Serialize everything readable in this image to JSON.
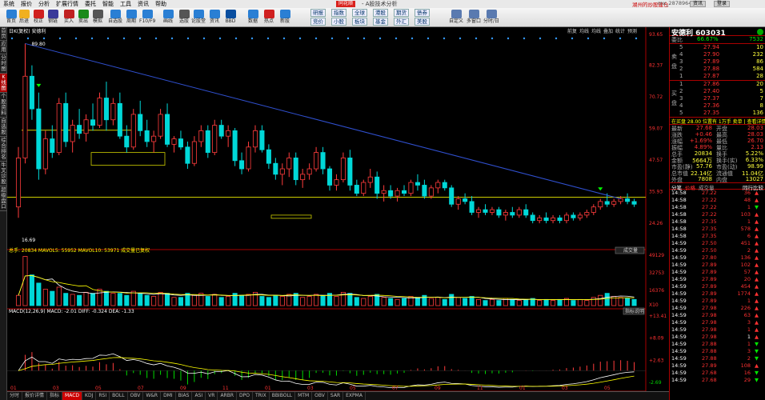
{
  "menu": [
    "系统",
    "报价",
    "分析",
    "扩展行情",
    "委托",
    "智能",
    "工具",
    "资讯",
    "帮助"
  ],
  "app_logo": "同花顺",
  "window_title": "- A股技术分析",
  "user_label": "湖州的炒股建仓",
  "account": "mx_287896434",
  "top_buttons": [
    "资讯",
    "登录"
  ],
  "toolbar": [
    "首页",
    "后退",
    "校正",
    "钢链",
    "买入",
    "卖出",
    "模拟",
    "自选股",
    "周期",
    "F10/F9",
    "画线",
    "选股",
    "论股堂",
    "资讯",
    "BBD",
    "数据",
    "热点",
    "新股"
  ],
  "toolbar_grid": [
    [
      "研报",
      "竞价"
    ],
    [
      "指数",
      "小股"
    ],
    [
      "全球",
      "板块"
    ],
    [
      "港股",
      "基金"
    ],
    [
      "期货",
      "外汇"
    ],
    [
      "债券",
      "美股"
    ]
  ],
  "toolbar_right": [
    "自定义",
    "多窗口",
    "分时/日"
  ],
  "left_nav": [
    "首页",
    "应用",
    "分时图",
    "K线图",
    "个股资料",
    "自选股",
    "综合排名",
    "牛叉诊股",
    "超级盘口"
  ],
  "kline": {
    "header": "日K(复权)   安德利",
    "right_tags": [
      "前复",
      "均线",
      "均线",
      "叠加",
      "统计",
      "预测"
    ],
    "max_label": "89.80",
    "min_label": "16.69",
    "y_ticks": [
      "93.65",
      "82.37",
      "70.72",
      "59.07",
      "47.57",
      "35.93",
      "24.26"
    ],
    "volume_header": "总手: 20834  MAVOL5: 55952  MAVOL10: 53971  成交量已复权",
    "vol_sel": "成交量",
    "vol_ticks": [
      "49129",
      "32753",
      "16376",
      "X10"
    ],
    "macd_header": "MACD(12,26,9)  MACD: -2.01  DIFF: -0.324  DEA: -1.33",
    "macd_btn": "指标说明",
    "macd_ticks": [
      "+13.41",
      "+8.09",
      "+2.63",
      "-2.69"
    ],
    "x_ticks": [
      "01",
      "03",
      "05",
      "07",
      "09",
      "11",
      "01",
      "03",
      "05",
      "07",
      "09",
      "11",
      "01",
      "03",
      "05"
    ]
  },
  "chart_data": {
    "type": "candlestick",
    "ohlc": [
      [
        30,
        52,
        26,
        48
      ],
      [
        48,
        90,
        46,
        78
      ],
      [
        78,
        82,
        62,
        66
      ],
      [
        66,
        72,
        40,
        44
      ],
      [
        44,
        58,
        42,
        55
      ],
      [
        55,
        60,
        48,
        50
      ],
      [
        50,
        70,
        49,
        68
      ],
      [
        68,
        72,
        52,
        54
      ],
      [
        54,
        62,
        50,
        60
      ],
      [
        60,
        66,
        55,
        57
      ],
      [
        57,
        64,
        54,
        62
      ],
      [
        62,
        68,
        58,
        60
      ],
      [
        60,
        72,
        59,
        70
      ],
      [
        70,
        76,
        58,
        62
      ],
      [
        62,
        70,
        60,
        68
      ],
      [
        68,
        72,
        55,
        56
      ],
      [
        56,
        60,
        50,
        52
      ],
      [
        52,
        66,
        51,
        64
      ],
      [
        64,
        69,
        56,
        58
      ],
      [
        58,
        62,
        52,
        54
      ],
      [
        54,
        58,
        50,
        56
      ],
      [
        56,
        66,
        55,
        64
      ],
      [
        64,
        68,
        52,
        53
      ],
      [
        53,
        56,
        50,
        55
      ],
      [
        55,
        58,
        51,
        52
      ],
      [
        52,
        54,
        44,
        46
      ],
      [
        46,
        56,
        45,
        54
      ],
      [
        54,
        60,
        52,
        58
      ],
      [
        58,
        60,
        48,
        50
      ],
      [
        50,
        62,
        49,
        60
      ],
      [
        60,
        62,
        55,
        56
      ],
      [
        56,
        60,
        52,
        58
      ],
      [
        58,
        59,
        45,
        47
      ],
      [
        47,
        50,
        42,
        44
      ],
      [
        44,
        54,
        43,
        52
      ],
      [
        52,
        60,
        50,
        58
      ],
      [
        58,
        60,
        50,
        51
      ],
      [
        51,
        53,
        44,
        46
      ],
      [
        46,
        48,
        40,
        42
      ],
      [
        42,
        46,
        38,
        44
      ],
      [
        44,
        50,
        41,
        48
      ],
      [
        48,
        50,
        38,
        40
      ],
      [
        40,
        44,
        37,
        42
      ],
      [
        42,
        46,
        40,
        44
      ],
      [
        44,
        52,
        43,
        50
      ],
      [
        50,
        52,
        42,
        44
      ],
      [
        44,
        45,
        36,
        38
      ],
      [
        38,
        42,
        36,
        40
      ],
      [
        40,
        50,
        39,
        48
      ],
      [
        48,
        51,
        36,
        38
      ],
      [
        38,
        40,
        34,
        35
      ],
      [
        35,
        40,
        34,
        39
      ],
      [
        39,
        44,
        37,
        41
      ],
      [
        41,
        43,
        33,
        35
      ],
      [
        35,
        38,
        32,
        36
      ],
      [
        36,
        38,
        33,
        34
      ],
      [
        34,
        37,
        32,
        36
      ],
      [
        36,
        38,
        34,
        35
      ],
      [
        35,
        40,
        34,
        39
      ],
      [
        39,
        42,
        36,
        38
      ],
      [
        38,
        40,
        33,
        34
      ],
      [
        34,
        38,
        33,
        37
      ],
      [
        37,
        40,
        35,
        39
      ],
      [
        39,
        40,
        36,
        37
      ],
      [
        37,
        38,
        30,
        31
      ],
      [
        31,
        34,
        29,
        33
      ],
      [
        33,
        35,
        31,
        32
      ],
      [
        32,
        34,
        27,
        28
      ],
      [
        28,
        30,
        26,
        29
      ],
      [
        29,
        31,
        27,
        28
      ],
      [
        28,
        30,
        27,
        29
      ],
      [
        29,
        30,
        26,
        27
      ],
      [
        27,
        29,
        25,
        28
      ],
      [
        28,
        30,
        26,
        27
      ],
      [
        27,
        30,
        26,
        29
      ],
      [
        29,
        31,
        26,
        27
      ],
      [
        27,
        28,
        24,
        25
      ],
      [
        25,
        27,
        24,
        26
      ],
      [
        26,
        28,
        24,
        25
      ],
      [
        25,
        27,
        24,
        26
      ],
      [
        26,
        27,
        24,
        25
      ],
      [
        25,
        28,
        24,
        27
      ],
      [
        27,
        28,
        25,
        26
      ],
      [
        26,
        28,
        25,
        27
      ],
      [
        27,
        29,
        26,
        28
      ],
      [
        28,
        31,
        27,
        30
      ],
      [
        30,
        33,
        29,
        32
      ],
      [
        32,
        35,
        30,
        31
      ],
      [
        31,
        33,
        30,
        32
      ],
      [
        32,
        34,
        31,
        33
      ],
      [
        33,
        35,
        31,
        32
      ],
      [
        32,
        33,
        30,
        31
      ]
    ],
    "volume": [
      10,
      48,
      30,
      22,
      16,
      14,
      18,
      12,
      11,
      10,
      13,
      12,
      16,
      14,
      12,
      12,
      10,
      14,
      12,
      10,
      9,
      13,
      12,
      8,
      8,
      12,
      10,
      12,
      9,
      11,
      8,
      9,
      12,
      10,
      11,
      13,
      9,
      8,
      10,
      9,
      11,
      12,
      8,
      9,
      11,
      10,
      12,
      9,
      13,
      12,
      8,
      7,
      9,
      11,
      8,
      7,
      6,
      7,
      9,
      8,
      10,
      7,
      8,
      6,
      11,
      8,
      7,
      9,
      6,
      5,
      6,
      5,
      7,
      6,
      5,
      6,
      7,
      5,
      6,
      5,
      6,
      7,
      5,
      6,
      5,
      8,
      10,
      12,
      9,
      8,
      7,
      6
    ],
    "ylim": [
      16.69,
      93.65
    ],
    "macd_ylim": [
      -4,
      13.41
    ]
  },
  "quote": {
    "name": "安德利",
    "code": "603031",
    "weibi_label": "委比",
    "weibi": "66.67%",
    "weicha": "7532",
    "sell_label": "卖盘",
    "buy_label": "买盘",
    "asks": [
      [
        "5",
        "27.94",
        "10"
      ],
      [
        "4",
        "27.90",
        "232"
      ],
      [
        "3",
        "27.89",
        "86"
      ],
      [
        "2",
        "27.88",
        "584"
      ],
      [
        "1",
        "27.87",
        "28"
      ]
    ],
    "bids": [
      [
        "1",
        "27.86",
        "20"
      ],
      [
        "2",
        "27.40",
        "5"
      ],
      [
        "3",
        "27.37",
        "7"
      ],
      [
        "4",
        "27.36",
        "8"
      ],
      [
        "5",
        "27.35",
        "136"
      ]
    ],
    "fund_row": "在买盘 28.00 位置有  1万手  卖单 | 查看详情",
    "stats_left": [
      [
        "最新",
        "27.68"
      ],
      [
        "涨跌",
        "+0.46"
      ],
      [
        "涨幅",
        "+1.69%"
      ],
      [
        "振幅",
        "4.89%"
      ],
      [
        "总手",
        "20834"
      ],
      [
        "金额",
        "5664万"
      ],
      [
        "市盈(静)",
        "57.76"
      ],
      [
        "总市值",
        "22.14亿"
      ],
      [
        "外盘",
        "7808"
      ]
    ],
    "stats_right": [
      [
        "开盘",
        "28.03"
      ],
      [
        "最高",
        "28.03"
      ],
      [
        "最低",
        "26.70"
      ],
      [
        "量比",
        "2.13"
      ],
      [
        "换手",
        "5.22%"
      ],
      [
        "换手(实)",
        "6.33%"
      ],
      [
        "市盈(动)",
        "98.99"
      ],
      [
        "流通值",
        "11.04亿"
      ],
      [
        "内盘",
        "13027"
      ]
    ],
    "tabs": [
      "分笔",
      "价格",
      "成交量"
    ],
    "tab_right": "同行比较",
    "ticks": [
      [
        "14:58",
        "27.22",
        "36"
      ],
      [
        "14:58",
        "27.22",
        "48"
      ],
      [
        "14:58",
        "27.22",
        "1"
      ],
      [
        "14:58",
        "27.22",
        "103"
      ],
      [
        "14:58",
        "27.35",
        "1"
      ],
      [
        "14:58",
        "27.35",
        "578"
      ],
      [
        "14:58",
        "27.35",
        "6"
      ],
      [
        "14:59",
        "27.50",
        "451"
      ],
      [
        "14:59",
        "27.50",
        "2"
      ],
      [
        "14:59",
        "27.80",
        "136"
      ],
      [
        "14:59",
        "27.89",
        "102"
      ],
      [
        "14:59",
        "27.89",
        "57"
      ],
      [
        "14:59",
        "27.89",
        "20"
      ],
      [
        "14:59",
        "27.89",
        "454"
      ],
      [
        "14:59",
        "27.89",
        "1774"
      ],
      [
        "14:59",
        "27.89",
        "1"
      ],
      [
        "14:59",
        "27.98",
        "226"
      ],
      [
        "14:59",
        "27.98",
        "63"
      ],
      [
        "14:59",
        "27.98",
        "3"
      ],
      [
        "14:59",
        "27.98",
        "1"
      ],
      [
        "14:59",
        "27.98",
        "1"
      ],
      [
        "14:59",
        "27.88",
        "1"
      ],
      [
        "14:59",
        "27.88",
        "3"
      ],
      [
        "14:59",
        "27.88",
        "2"
      ],
      [
        "14:59",
        "27.89",
        "108"
      ],
      [
        "14:59",
        "27.68",
        "16"
      ],
      [
        "14:59",
        "27.68",
        "29"
      ]
    ],
    "tick_flags": [
      "up",
      "up",
      "dn",
      "up",
      "up",
      "up",
      "up",
      "up",
      "up",
      "up",
      "up",
      "up",
      "up",
      "up",
      "up",
      "up",
      "up",
      "up",
      "up",
      "up",
      "up",
      "dn",
      "dn",
      "dn",
      "up",
      "dn",
      "dn"
    ]
  },
  "bottom_tabs": [
    "分时",
    "报价详情",
    "指标",
    "MACD",
    "KDJ",
    "RSI",
    "BOLL",
    "OBV",
    "W&R",
    "DMI",
    "BIAS",
    "ASI",
    "VR",
    "ARBR",
    "DPO",
    "TRIX",
    "BBIBOLL",
    "MTM",
    "OBV",
    "SAR",
    "EXPMA"
  ]
}
